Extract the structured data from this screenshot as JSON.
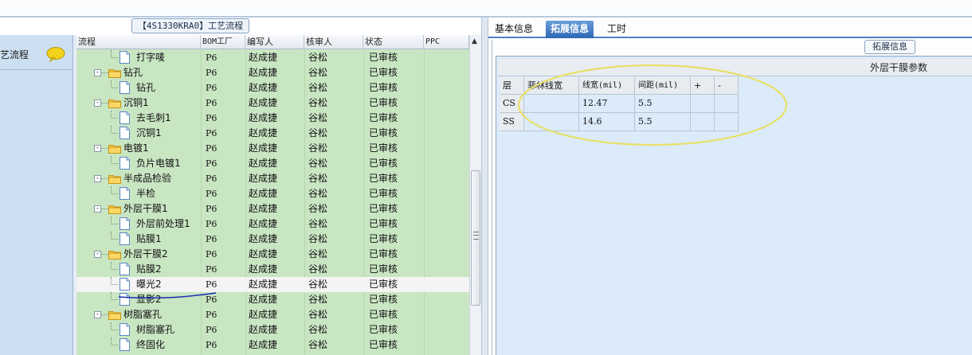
{
  "window": {
    "process_title": "【4S1330KRA0】工艺流程"
  },
  "left_nav": {
    "item_label": "艺流程",
    "item_icon": "chat-bubble-icon"
  },
  "tree": {
    "columns": [
      "流程",
      "BOM工厂",
      "编写人",
      "核审人",
      "状态",
      "PPC"
    ],
    "rows": [
      {
        "name": "打字唛",
        "type": "doc",
        "level": 2,
        "bom": "P6",
        "writer": "赵成捷",
        "reviewer": "谷松",
        "status": "已审核"
      },
      {
        "name": "钻孔",
        "type": "folder",
        "level": 1,
        "bom": "P6",
        "writer": "赵成捷",
        "reviewer": "谷松",
        "status": "已审核"
      },
      {
        "name": "钻孔",
        "type": "doc",
        "level": 2,
        "bom": "P6",
        "writer": "赵成捷",
        "reviewer": "谷松",
        "status": "已审核"
      },
      {
        "name": "沉铜1",
        "type": "folder",
        "level": 1,
        "bom": "P6",
        "writer": "赵成捷",
        "reviewer": "谷松",
        "status": "已审核"
      },
      {
        "name": "去毛刺1",
        "type": "doc",
        "level": 2,
        "bom": "P6",
        "writer": "赵成捷",
        "reviewer": "谷松",
        "status": "已审核"
      },
      {
        "name": "沉铜1",
        "type": "doc",
        "level": 2,
        "bom": "P6",
        "writer": "赵成捷",
        "reviewer": "谷松",
        "status": "已审核"
      },
      {
        "name": "电镀1",
        "type": "folder",
        "level": 1,
        "bom": "P6",
        "writer": "赵成捷",
        "reviewer": "谷松",
        "status": "已审核"
      },
      {
        "name": "负片电镀1",
        "type": "doc",
        "level": 2,
        "bom": "P6",
        "writer": "赵成捷",
        "reviewer": "谷松",
        "status": "已审核"
      },
      {
        "name": "半成品检验",
        "type": "folder",
        "level": 1,
        "bom": "P6",
        "writer": "赵成捷",
        "reviewer": "谷松",
        "status": "已审核"
      },
      {
        "name": "半检",
        "type": "doc",
        "level": 2,
        "bom": "P6",
        "writer": "赵成捷",
        "reviewer": "谷松",
        "status": "已审核"
      },
      {
        "name": "外层干膜1",
        "type": "folder",
        "level": 1,
        "bom": "P6",
        "writer": "赵成捷",
        "reviewer": "谷松",
        "status": "已审核"
      },
      {
        "name": "外层前处理1",
        "type": "doc",
        "level": 2,
        "bom": "P6",
        "writer": "赵成捷",
        "reviewer": "谷松",
        "status": "已审核"
      },
      {
        "name": "贴膜1",
        "type": "doc",
        "level": 2,
        "bom": "P6",
        "writer": "赵成捷",
        "reviewer": "谷松",
        "status": "已审核"
      },
      {
        "name": "外层干膜2",
        "type": "folder",
        "level": 1,
        "bom": "P6",
        "writer": "赵成捷",
        "reviewer": "谷松",
        "status": "已审核"
      },
      {
        "name": "贴膜2",
        "type": "doc",
        "level": 2,
        "bom": "P6",
        "writer": "赵成捷",
        "reviewer": "谷松",
        "status": "已审核"
      },
      {
        "name": "曝光2",
        "type": "doc",
        "level": 2,
        "bom": "P6",
        "writer": "赵成捷",
        "reviewer": "谷松",
        "status": "已审核",
        "selected": true
      },
      {
        "name": "显影2",
        "type": "doc",
        "level": 2,
        "bom": "P6",
        "writer": "赵成捷",
        "reviewer": "谷松",
        "status": "已审核"
      },
      {
        "name": "树脂塞孔",
        "type": "folder",
        "level": 1,
        "bom": "P6",
        "writer": "赵成捷",
        "reviewer": "谷松",
        "status": "已审核"
      },
      {
        "name": "树脂塞孔",
        "type": "doc",
        "level": 2,
        "bom": "P6",
        "writer": "赵成捷",
        "reviewer": "谷松",
        "status": "已审核"
      },
      {
        "name": "终固化",
        "type": "doc",
        "level": 2,
        "bom": "P6",
        "writer": "赵成捷",
        "reviewer": "谷松",
        "status": "已审核"
      },
      {
        "name": "",
        "type": "folder",
        "level": 1,
        "bom": "",
        "writer": "",
        "reviewer": "",
        "status": ""
      }
    ]
  },
  "right": {
    "tabs": [
      "基本信息",
      "拓展信息",
      "工时"
    ],
    "active_tab": 1,
    "ext_group_label": "拓展信息",
    "param_title": "外层干膜参数",
    "grid_columns": [
      "层",
      "菲林线宽",
      "线宽(mil)",
      "间距(mil)",
      "+",
      "-"
    ],
    "grid_rows": [
      {
        "layer": "CS",
        "film_width": "",
        "line_width": "12.47",
        "spacing": "5.5"
      },
      {
        "layer": "SS",
        "film_width": "",
        "line_width": "14.6",
        "spacing": "5.5"
      }
    ]
  },
  "colors": {
    "tree_bg": "#c9e6c3",
    "tab_active": "#2d67b4",
    "highlight_ellipse": "#e8e06a",
    "pen_underline": "#1e2fb0"
  }
}
